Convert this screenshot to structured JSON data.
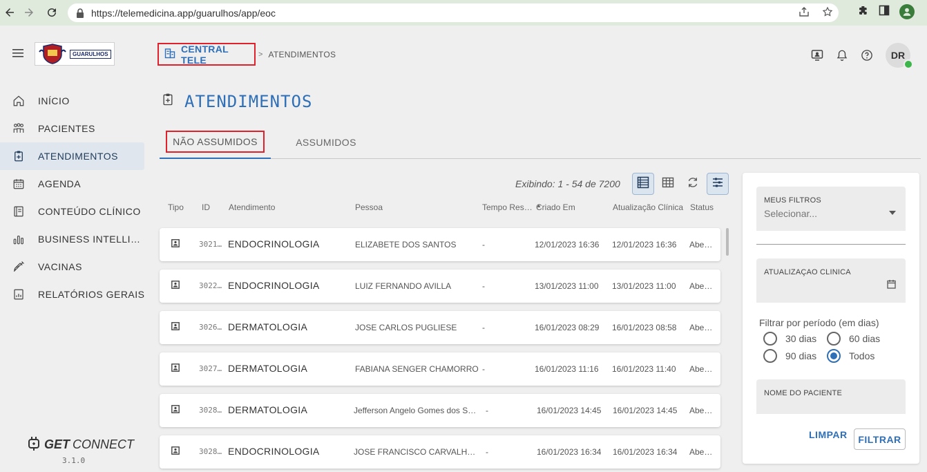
{
  "browser": {
    "url": "https://telemedicina.app/guarulhos/app/eoc"
  },
  "header": {
    "logo_text": "GUARULHOS",
    "breadcrumb_home": "CENTRAL TELE",
    "breadcrumb_sep": ">",
    "breadcrumb_current": "ATENDIMENTOS",
    "avatar_initials": "DR"
  },
  "sidebar": {
    "items": [
      {
        "label": "INÍCIO",
        "icon": "home-icon"
      },
      {
        "label": "PACIENTES",
        "icon": "people-icon"
      },
      {
        "label": "ATENDIMENTOS",
        "icon": "clipboard-plus-icon",
        "active": true
      },
      {
        "label": "AGENDA",
        "icon": "calendar-icon"
      },
      {
        "label": "CONTEÚDO CLÍNICO",
        "icon": "book-icon"
      },
      {
        "label": "BUSINESS INTELLI…",
        "icon": "bar-chart-icon"
      },
      {
        "label": "VACINAS",
        "icon": "syringe-icon"
      },
      {
        "label": "RELATÓRIOS GERAIS",
        "icon": "report-icon"
      }
    ],
    "brand_bold": "GET",
    "brand_rest": "CONNECT",
    "version": "3.1.0"
  },
  "page": {
    "title": "ATENDIMENTOS",
    "tabs": [
      {
        "label": "NÃO ASSUMIDOS",
        "active": true
      },
      {
        "label": "ASSUMIDOS",
        "active": false
      }
    ]
  },
  "table": {
    "showing": "Exibindo: 1 - 54 de 7200",
    "columns": [
      "Tipo",
      "ID",
      "Atendimento",
      "Pessoa",
      "Tempo Res…",
      "Criado Em",
      "Atualização Clínica",
      "Status"
    ],
    "sort_indicator": "▲",
    "rows": [
      {
        "id": "3021…",
        "atendimento": "ENDOCRINOLOGIA",
        "pessoa": "ELIZABETE DOS SANTOS",
        "tempo": "-",
        "criado": "12/01/2023 16:36",
        "atualizacao": "12/01/2023 16:36",
        "status": "Aber…"
      },
      {
        "id": "3022…",
        "atendimento": "ENDOCRINOLOGIA",
        "pessoa": "LUIZ FERNANDO AVILLA",
        "tempo": "-",
        "criado": "13/01/2023 11:00",
        "atualizacao": "13/01/2023 11:00",
        "status": "Aber…"
      },
      {
        "id": "3026…",
        "atendimento": "DERMATOLOGIA",
        "pessoa": "JOSE CARLOS PUGLIESE",
        "tempo": "-",
        "criado": "16/01/2023 08:29",
        "atualizacao": "16/01/2023 08:58",
        "status": "Aber…"
      },
      {
        "id": "3027…",
        "atendimento": "DERMATOLOGIA",
        "pessoa": "FABIANA SENGER CHAMORRO",
        "tempo": "-",
        "criado": "16/01/2023 11:16",
        "atualizacao": "16/01/2023 11:40",
        "status": "Aber…"
      },
      {
        "id": "3028…",
        "atendimento": "DERMATOLOGIA",
        "pessoa": "Jefferson Angelo Gomes dos S…",
        "tempo": "-",
        "criado": "16/01/2023 14:45",
        "atualizacao": "16/01/2023 14:45",
        "status": "Aber…"
      },
      {
        "id": "3028…",
        "atendimento": "ENDOCRINOLOGIA",
        "pessoa": "JOSE FRANCISCO CARVALHO B…",
        "tempo": "-",
        "criado": "16/01/2023 16:34",
        "atualizacao": "16/01/2023 16:34",
        "status": "Aber…"
      }
    ]
  },
  "filters": {
    "my_filters_label": "MEUS FILTROS",
    "my_filters_placeholder": "Selecionar...",
    "clinical_update_label": "ATUALIZAÇAO CLINICA",
    "period_label": "Filtrar por período (em dias)",
    "period_options": [
      {
        "label": "30 dias",
        "selected": false
      },
      {
        "label": "60 dias",
        "selected": false
      },
      {
        "label": "90 dias",
        "selected": false
      },
      {
        "label": "Todos",
        "selected": true
      }
    ],
    "patient_name_label": "NOME DO PACIENTE",
    "clear_label": "LIMPAR",
    "filter_label": "FILTRAR"
  },
  "colors": {
    "accent": "#2e6fb7",
    "highlight_box": "#e0202a",
    "chrome_bg": "#dfe9dc"
  }
}
